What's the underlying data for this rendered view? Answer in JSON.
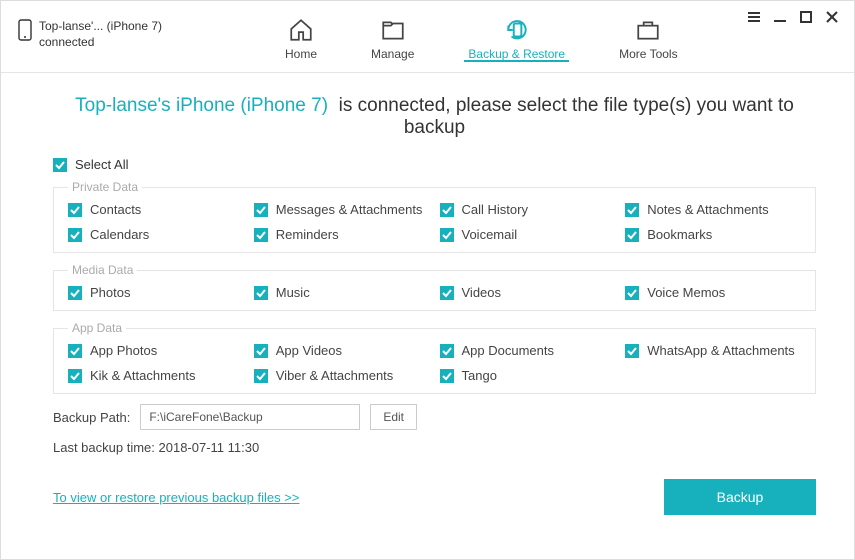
{
  "header": {
    "device_name": "Top-lanse'... (iPhone 7)",
    "device_status": "connected",
    "tabs": [
      {
        "label": "Home"
      },
      {
        "label": "Manage"
      },
      {
        "label": "Backup & Restore"
      },
      {
        "label": "More Tools"
      }
    ]
  },
  "main": {
    "headline_device": "Top-lanse's iPhone (iPhone 7)",
    "headline_text1": "is connected, please select the file type(s) you want to",
    "headline_text2": "backup",
    "select_all": "Select All",
    "path_label": "Backup Path:",
    "path_value": "F:\\iCareFone\\Backup",
    "edit_btn": "Edit",
    "last_backup": "Last backup time: 2018-07-11 11:30",
    "restore_link": "To view or restore previous backup files >>",
    "backup_btn": "Backup"
  },
  "groups": [
    {
      "title": "Private Data",
      "items": [
        "Contacts",
        "Messages & Attachments",
        "Call History",
        "Notes & Attachments",
        "Calendars",
        "Reminders",
        "Voicemail",
        "Bookmarks"
      ]
    },
    {
      "title": "Media Data",
      "items": [
        "Photos",
        "Music",
        "Videos",
        "Voice Memos"
      ]
    },
    {
      "title": "App Data",
      "items": [
        "App Photos",
        "App Videos",
        "App Documents",
        "WhatsApp & Attachments",
        "Kik & Attachments",
        "Viber & Attachments",
        "Tango"
      ]
    }
  ]
}
